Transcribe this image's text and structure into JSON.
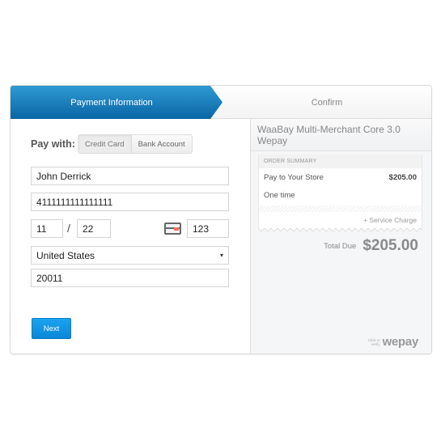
{
  "steps": [
    {
      "label": "Payment Information",
      "active": true
    },
    {
      "label": "Confirm",
      "active": false
    }
  ],
  "form": {
    "pay_with_label": "Pay with:",
    "payment_methods": [
      {
        "label": "Credit Card",
        "selected": true
      },
      {
        "label": "Bank Account",
        "selected": false
      }
    ],
    "name": "John Derrick",
    "card_number": "4111111111111111",
    "exp_month": "11",
    "exp_separator": "/",
    "exp_year": "22",
    "cvv": "123",
    "country": "United States",
    "country_caret": "▾",
    "zip": "20011",
    "next_label": "Next"
  },
  "summary": {
    "merchant_title": "WaaBay Multi-Merchant Core 3.0 Wepay",
    "header": "ORDER SUMMARY",
    "item_label": "Pay to Your Store",
    "item_amount": "$205.00",
    "frequency": "One time",
    "service_charge": "+ Service Charge",
    "total_label": "Total Due",
    "total_amount": "$205.00"
  },
  "footer": {
    "verify_line1": "Click to",
    "verify_line2": "verify",
    "brand": "wepay"
  }
}
